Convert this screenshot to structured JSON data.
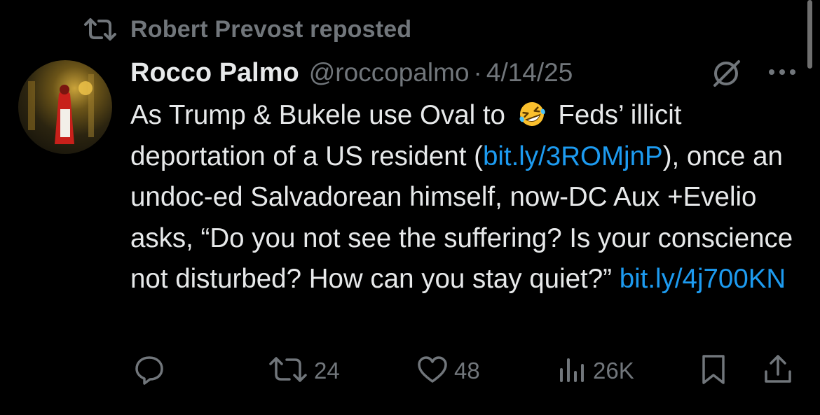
{
  "repost": {
    "icon": "repost-icon",
    "text": "Robert Prevost reposted"
  },
  "author": {
    "avatar": "avatar",
    "name": "Rocco Palmo",
    "handle": "@roccopalmo",
    "separator": "·",
    "date": "4/14/25"
  },
  "tweet": {
    "line1_prefix": "As Trump & Bukele use Oval to ",
    "emoji": "rolling-on-floor-laughing-emoji",
    "line1_suffix": " Feds’ illicit deportation of a US resident (",
    "link1": "bit.ly/3ROMjnP",
    "body": "), once an undoc-ed Salvadorean himself, now-DC Aux +Evelio asks, “Do you not see the suffering? Is your conscience not disturbed? How can you stay quiet?” ",
    "link2": "bit.ly/4j700KN"
  },
  "actions": {
    "reply_icon": "reply-icon",
    "repost_icon": "repost-icon",
    "repost_count": "24",
    "like_icon": "heart-icon",
    "like_count": "48",
    "views_icon": "views-icon",
    "views_count": "26K",
    "bookmark_icon": "bookmark-icon",
    "share_icon": "share-icon"
  },
  "colors": {
    "background": "#000000",
    "text": "#e7e9ea",
    "muted": "#71767b",
    "link": "#1d9bf0"
  }
}
